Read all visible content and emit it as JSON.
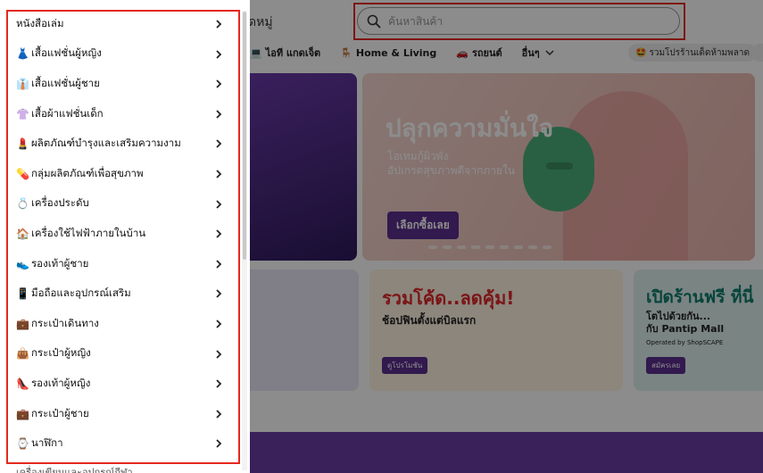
{
  "header": {
    "category_title": "ดหมู่",
    "search_placeholder": "ค้นหาสินค้า"
  },
  "category_nav": [
    {
      "icon": "laptop-icon",
      "glyph": "💻",
      "label": "ไอที แกดเจ็ต"
    },
    {
      "icon": "chair-icon",
      "glyph": "🪑",
      "label": "Home & Living"
    },
    {
      "icon": "car-icon",
      "glyph": "🚗",
      "label": "รถยนต์"
    },
    {
      "icon": "more-icon",
      "glyph": "",
      "label": "อื่นๆ"
    }
  ],
  "promo_pill": {
    "glyph": "🤩",
    "label": "รวมโปรร้านเด็ดห้ามพลาด"
  },
  "hero_banner": {
    "title": "ปลุกความมั่นใจ",
    "subtitle_line1": "โอเทมกู้ผิวพัง",
    "subtitle_line2": "อัปเกรดสุขภาพดีจากภายใน",
    "button": "เลือกซื้อเลย"
  },
  "promo_card_1": {
    "title": "รวมโค้ด..ลดคุ้ม!",
    "subtitle": "ช้อปฟินตั้งแต่บิลแรก",
    "button": "ดูโปรโมชัน"
  },
  "promo_card_2": {
    "title": "เปิดร้านฟรี ที่นี่",
    "line1": "โตไปด้วยกัน...",
    "line2": "กับ Pantip Mall",
    "line3": "Operated by ShopSCAPE",
    "button": "สมัครเลย"
  },
  "menu": {
    "items": [
      {
        "icon": "",
        "glyph": "",
        "label": "หนังสือเล่ม"
      },
      {
        "icon": "dress-icon",
        "glyph": "👗",
        "label": "เสื้อแฟชั่นผู้หญิง"
      },
      {
        "icon": "shirt-tie-icon",
        "glyph": "👔",
        "label": "เสื้อแฟชั่นผู้ชาย"
      },
      {
        "icon": "kids-shirt-icon",
        "glyph": "👚",
        "label": "เสื้อผ้าแฟชั่นเด็ก"
      },
      {
        "icon": "lipstick-icon",
        "glyph": "💄",
        "label": "ผลิตภัณฑ์บำรุงและเสริมความงาม"
      },
      {
        "icon": "pill-icon",
        "glyph": "💊",
        "label": "กลุ่มผลิตภัณฑ์เพื่อสุขภาพ"
      },
      {
        "icon": "ring-icon",
        "glyph": "💍",
        "label": "เครื่องประดับ"
      },
      {
        "icon": "house-icon",
        "glyph": "🏠",
        "label": "เครื่องใช้ไฟฟ้าภายในบ้าน"
      },
      {
        "icon": "sneaker-icon",
        "glyph": "👟",
        "label": "รองเท้าผู้ชาย"
      },
      {
        "icon": "phone-icon",
        "glyph": "📱",
        "label": "มือถือและอุปกรณ์เสริม"
      },
      {
        "icon": "luggage-icon",
        "glyph": "💼",
        "label": "กระเป๋าเดินทาง"
      },
      {
        "icon": "handbag-icon",
        "glyph": "👜",
        "label": "กระเป๋าผู้หญิง"
      },
      {
        "icon": "heel-icon",
        "glyph": "👠",
        "label": "รองเท้าผู้หญิง"
      },
      {
        "icon": "briefcase-icon",
        "glyph": "💼",
        "label": "กระเป๋าผู้ชาย"
      },
      {
        "icon": "watch-icon",
        "glyph": "⌚",
        "label": "นาฬิกา"
      }
    ],
    "peek_item": "เครื่องเขียนและอุปกรณ์กีฬา"
  },
  "colors": {
    "highlight_border": "#e5281e",
    "brand_purple": "#5b2f8e",
    "overlay": "rgba(0,0,0,0.45)"
  }
}
